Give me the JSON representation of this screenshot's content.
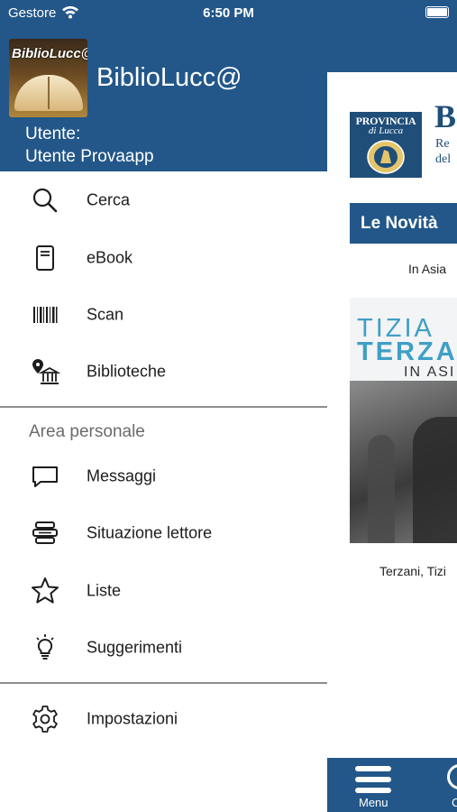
{
  "status_bar": {
    "carrier": "Gestore",
    "time": "6:50 PM"
  },
  "drawer": {
    "logo_text": "BiblioLucc@",
    "app_name": "BiblioLucc@",
    "user_label": "Utente:",
    "user_name": "Utente Provaapp",
    "primary_items": [
      {
        "label": "Cerca",
        "icon": "search-icon"
      },
      {
        "label": "eBook",
        "icon": "ebook-icon"
      },
      {
        "label": "Scan",
        "icon": "barcode-icon"
      },
      {
        "label": "Biblioteche",
        "icon": "library-location-icon"
      }
    ],
    "section_title": "Area personale",
    "personal_items": [
      {
        "label": "Messaggi",
        "icon": "message-icon"
      },
      {
        "label": "Situazione lettore",
        "icon": "reader-status-icon"
      },
      {
        "label": "Liste",
        "icon": "star-icon"
      },
      {
        "label": "Suggerimenti",
        "icon": "lightbulb-icon"
      }
    ],
    "settings_item": {
      "label": "Impostazioni",
      "icon": "gear-icon"
    }
  },
  "background": {
    "provincia_line1": "PROVINCIA",
    "provincia_line2": "di Lucca",
    "brand_letter": "B",
    "brand_sub1": "Re",
    "brand_sub2": "del",
    "novita_title": "Le Novità",
    "book_title": "In Asia",
    "cover_line1": "TIZIA",
    "cover_line2": "TERZA",
    "cover_line3": "IN ASI",
    "author": "Terzani, Tizi",
    "tab_menu_label": "Menu",
    "tab_second_label": "C"
  },
  "colors": {
    "primary": "#235789",
    "divider": "#8e8e8e",
    "section_title": "#6b6b6b"
  }
}
